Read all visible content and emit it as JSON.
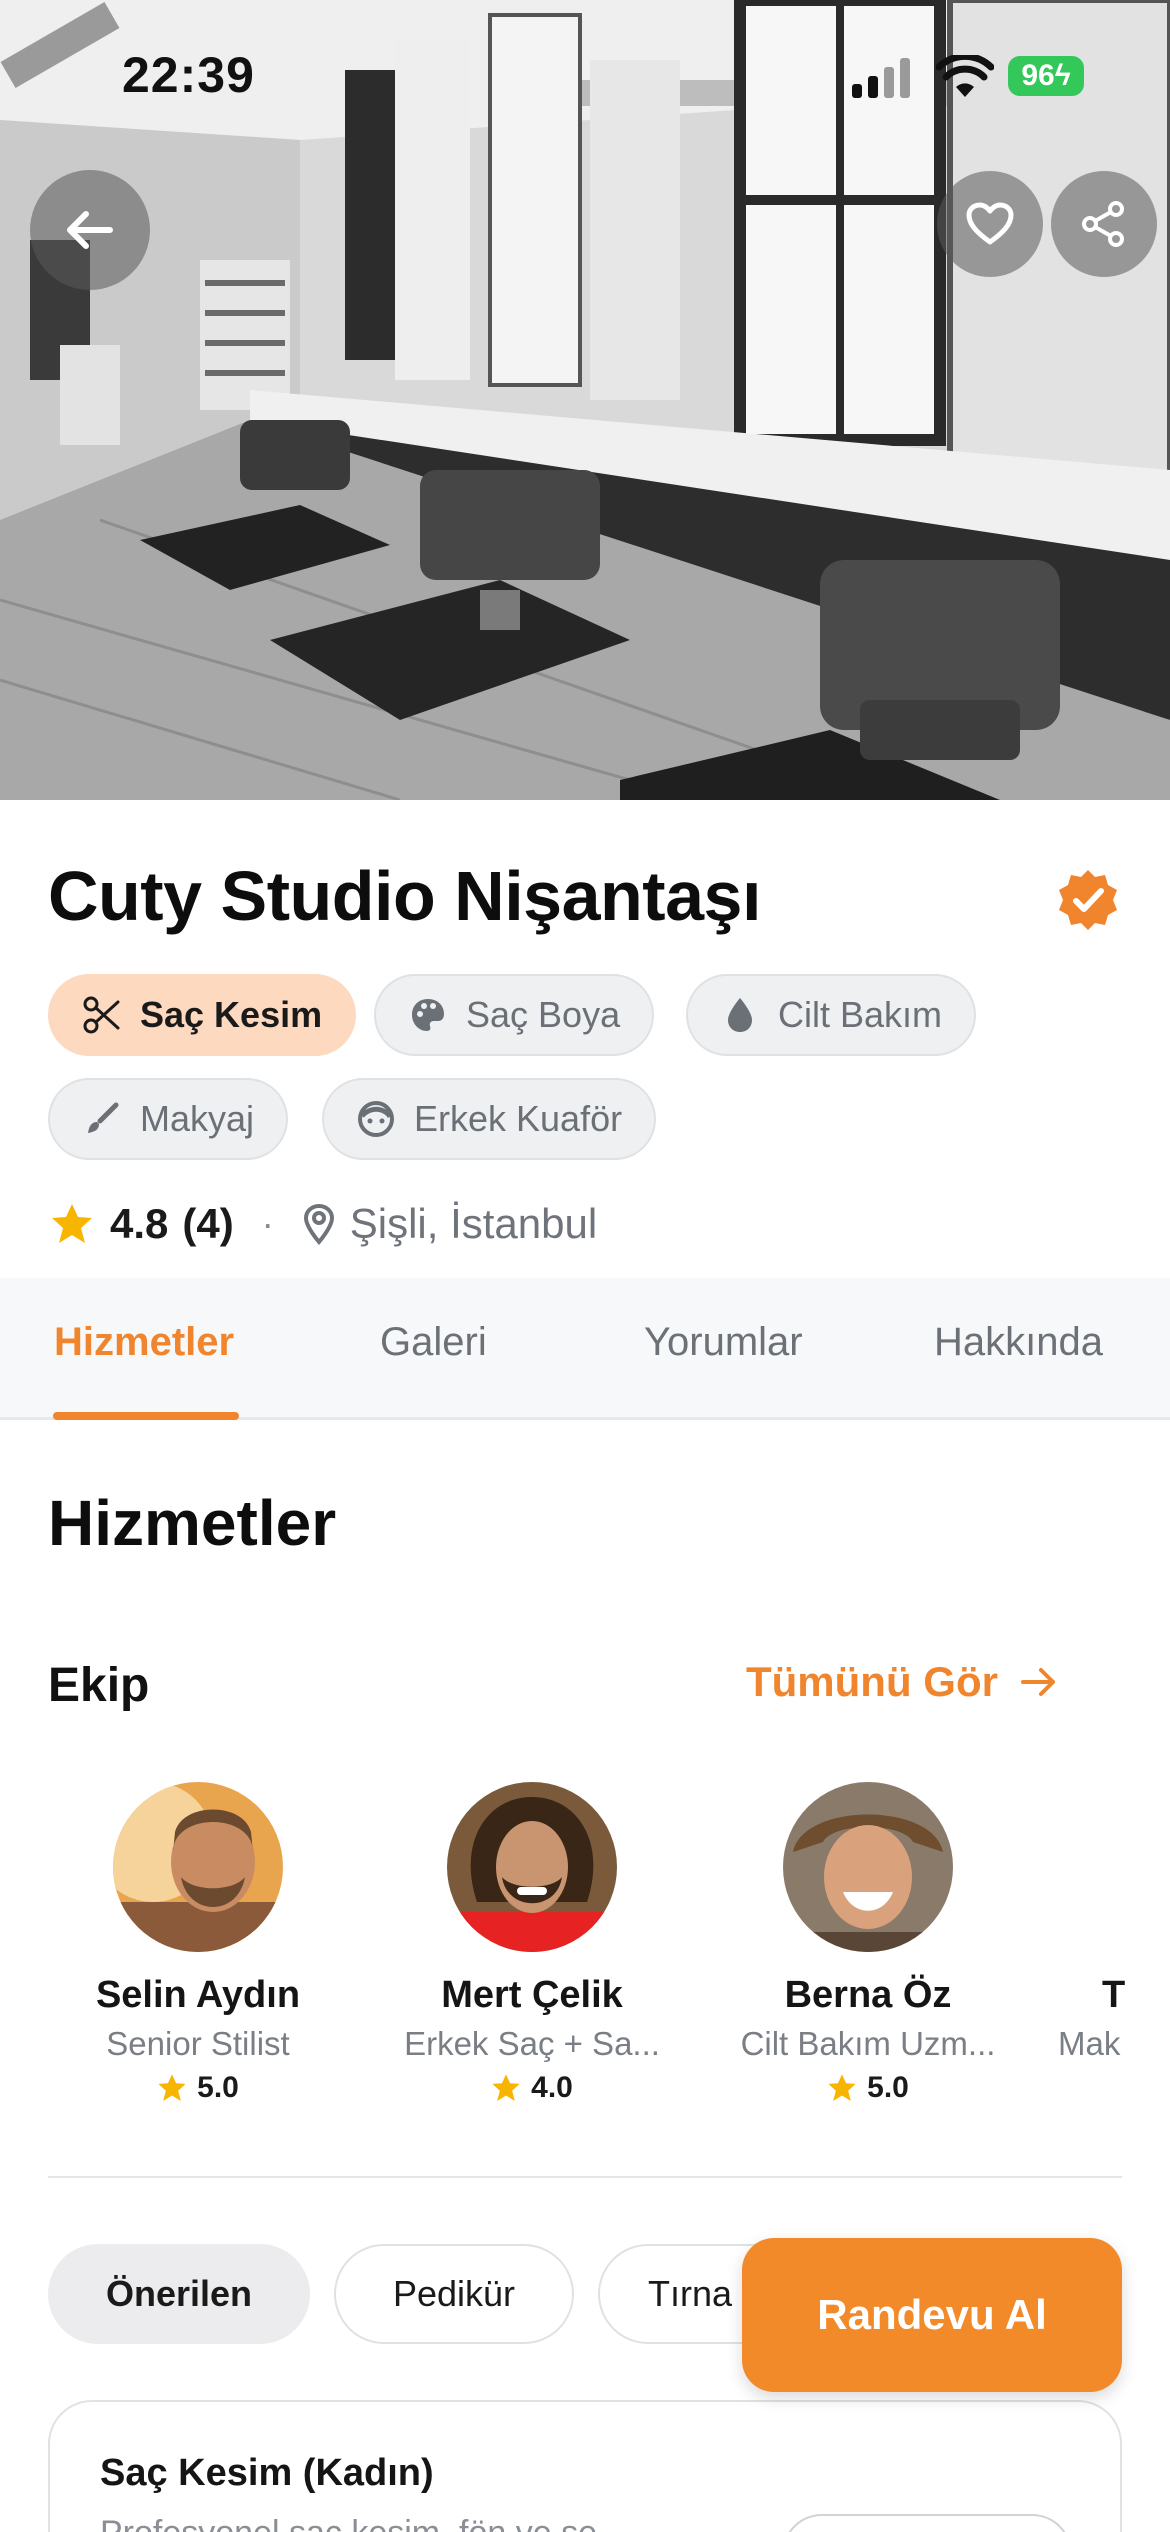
{
  "status": {
    "time": "22:39",
    "battery": "96"
  },
  "salon": {
    "name": "Cuty Studio Nişantaşı",
    "categories": [
      {
        "label": "Saç Kesim",
        "icon": "scissors-icon",
        "active": true
      },
      {
        "label": "Saç Boya",
        "icon": "palette-icon",
        "active": false
      },
      {
        "label": "Cilt Bakım",
        "icon": "droplet-icon",
        "active": false
      },
      {
        "label": "Makyaj",
        "icon": "brush-icon",
        "active": false
      },
      {
        "label": "Erkek Kuaför",
        "icon": "face-icon",
        "active": false
      }
    ],
    "rating": "4.8",
    "review_count": "(4)",
    "separator": "·",
    "location": "Şişli, İstanbul"
  },
  "tabs": [
    "Hizmetler",
    "Galeri",
    "Yorumlar",
    "Hakkında"
  ],
  "active_tab": "Hizmetler",
  "section_title": "Hizmetler",
  "team": {
    "label": "Ekip",
    "see_all": "Tümünü Gör",
    "members": [
      {
        "name": "Selin Aydın",
        "role": "Senior Stilist",
        "rating": "5.0"
      },
      {
        "name": "Mert Çelik",
        "role": "Erkek Saç + Sa...",
        "rating": "4.0"
      },
      {
        "name": "Berna Öz",
        "role": "Cilt Bakım Uzm...",
        "rating": "5.0"
      },
      {
        "name": "T",
        "role": "Mak",
        "rating": ""
      }
    ]
  },
  "filters": [
    "Önerilen",
    "Pedikür",
    "Tırna"
  ],
  "cta": "Randevu Al",
  "service": {
    "name": "Saç Kesim (Kadın)",
    "description": "Profesyonel saç kesim, fön ve şe"
  },
  "colors": {
    "accent": "#f0852d",
    "cta": "#f28a2a",
    "chip_active": "#fdd9c0",
    "battery": "#34c759"
  }
}
